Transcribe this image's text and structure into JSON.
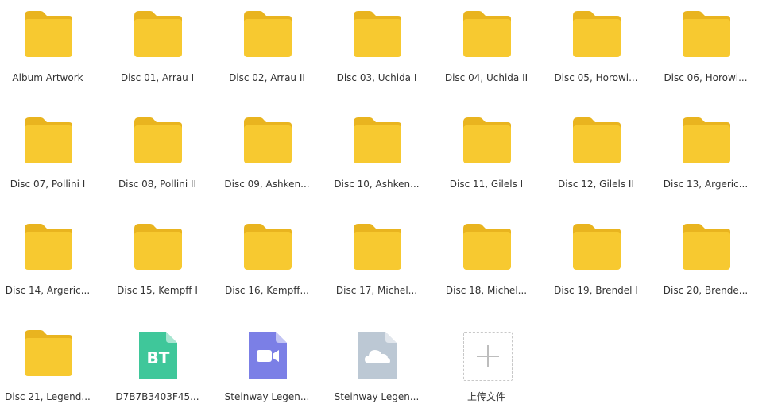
{
  "colors": {
    "folder_body": "#F7C930",
    "folder_tab": "#E9B41F",
    "bt_file": "#3FC79A",
    "video_file": "#7B7FE6",
    "cloud_file": "#BCC8D4",
    "file_fold": "#FFFFFF"
  },
  "items": [
    {
      "type": "folder",
      "icon": "folder-icon",
      "label": "Album Artwork"
    },
    {
      "type": "folder",
      "icon": "folder-icon",
      "label": "Disc 01, Arrau I"
    },
    {
      "type": "folder",
      "icon": "folder-icon",
      "label": "Disc 02, Arrau II"
    },
    {
      "type": "folder",
      "icon": "folder-icon",
      "label": "Disc 03, Uchida I"
    },
    {
      "type": "folder",
      "icon": "folder-icon",
      "label": "Disc 04, Uchida II"
    },
    {
      "type": "folder",
      "icon": "folder-icon",
      "label": "Disc 05, Horowi..."
    },
    {
      "type": "folder",
      "icon": "folder-icon",
      "label": "Disc 06, Horowi..."
    },
    {
      "type": "folder",
      "icon": "folder-icon",
      "label": "Disc 07, Pollini I"
    },
    {
      "type": "folder",
      "icon": "folder-icon",
      "label": "Disc 08, Pollini II"
    },
    {
      "type": "folder",
      "icon": "folder-icon",
      "label": "Disc 09, Ashken..."
    },
    {
      "type": "folder",
      "icon": "folder-icon",
      "label": "Disc 10, Ashken..."
    },
    {
      "type": "folder",
      "icon": "folder-icon",
      "label": "Disc 11, Gilels I"
    },
    {
      "type": "folder",
      "icon": "folder-icon",
      "label": "Disc 12, Gilels II"
    },
    {
      "type": "folder",
      "icon": "folder-icon",
      "label": "Disc 13, Argeric..."
    },
    {
      "type": "folder",
      "icon": "folder-icon",
      "label": "Disc 14, Argeric..."
    },
    {
      "type": "folder",
      "icon": "folder-icon",
      "label": "Disc 15, Kempff I"
    },
    {
      "type": "folder",
      "icon": "folder-icon",
      "label": "Disc 16, Kempff..."
    },
    {
      "type": "folder",
      "icon": "folder-icon",
      "label": "Disc 17, Michel..."
    },
    {
      "type": "folder",
      "icon": "folder-icon",
      "label": "Disc 18, Michel..."
    },
    {
      "type": "folder",
      "icon": "folder-icon",
      "label": "Disc 19, Brendel I"
    },
    {
      "type": "folder",
      "icon": "folder-icon",
      "label": "Disc 20, Brende..."
    },
    {
      "type": "folder",
      "icon": "folder-icon",
      "label": "Disc 21, Legend..."
    },
    {
      "type": "bt",
      "icon": "bt-file-icon",
      "badge": "BT",
      "label": "D7B7B3403F45..."
    },
    {
      "type": "video",
      "icon": "video-file-icon",
      "label": "Steinway Legen..."
    },
    {
      "type": "cloud",
      "icon": "cloud-file-icon",
      "label": "Steinway Legen..."
    },
    {
      "type": "upload",
      "icon": "plus-icon",
      "label": "上传文件"
    }
  ]
}
